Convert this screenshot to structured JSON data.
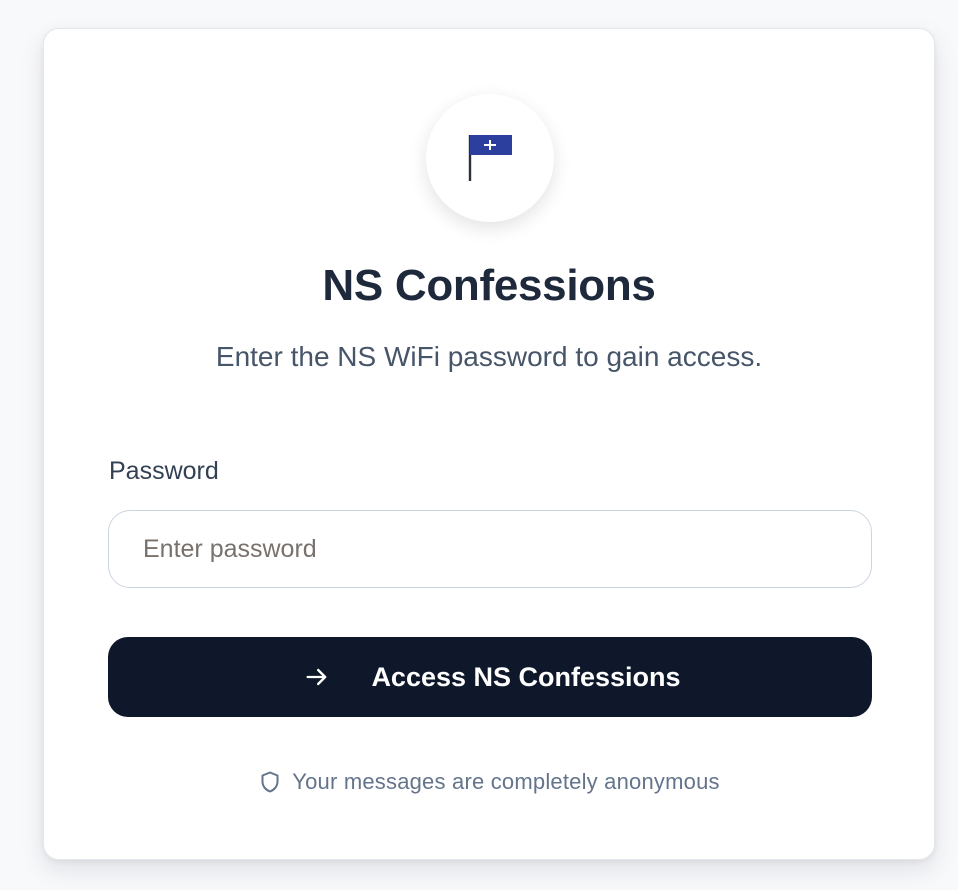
{
  "app": {
    "title": "NS Confessions",
    "subtitle": "Enter the NS WiFi password to gain access.",
    "logo_icon": "flag-icon",
    "flag_color": "#2c3e9e"
  },
  "form": {
    "password_label": "Password",
    "password_placeholder": "Enter password",
    "password_value": "",
    "submit_label": "Access NS Confessions",
    "submit_icon": "arrow-right-icon",
    "button_color": "#0f172a"
  },
  "footer": {
    "icon": "shield-icon",
    "text": "Your messages are completely anonymous"
  }
}
